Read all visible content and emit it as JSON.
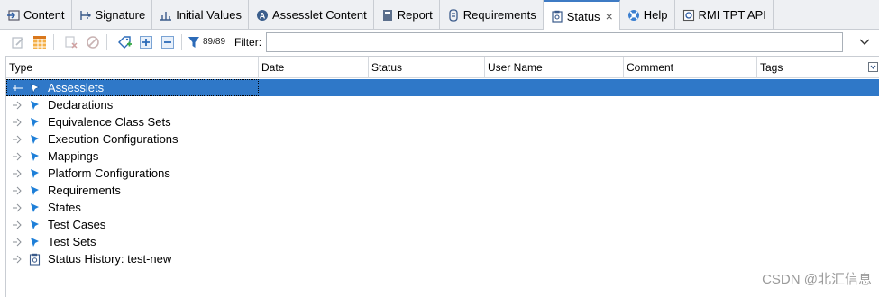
{
  "tabs": [
    {
      "label": "Content",
      "icon": "content-icon",
      "active": false
    },
    {
      "label": "Signature",
      "icon": "signature-icon",
      "active": false
    },
    {
      "label": "Initial Values",
      "icon": "initial-values-icon",
      "active": false
    },
    {
      "label": "Assesslet Content",
      "icon": "assesslet-icon",
      "active": false
    },
    {
      "label": "Report",
      "icon": "report-icon",
      "active": false
    },
    {
      "label": "Requirements",
      "icon": "requirements-icon",
      "active": false
    },
    {
      "label": "Status",
      "icon": "status-icon",
      "active": true,
      "close": "×"
    },
    {
      "label": "Help",
      "icon": "help-icon",
      "active": false
    },
    {
      "label": "RMI TPT API",
      "icon": "api-icon",
      "active": false
    }
  ],
  "toolbar": {
    "count": "89/89",
    "filter_label": "Filter:",
    "filter_value": ""
  },
  "table": {
    "columns": [
      "Type",
      "Date",
      "Status",
      "User Name",
      "Comment",
      "Tags"
    ],
    "rows": [
      {
        "label": "Assesslets",
        "selected": true,
        "icon": "pin-icon"
      },
      {
        "label": "Declarations",
        "selected": false,
        "icon": "pin-icon"
      },
      {
        "label": "Equivalence Class Sets",
        "selected": false,
        "icon": "pin-icon"
      },
      {
        "label": "Execution Configurations",
        "selected": false,
        "icon": "pin-icon"
      },
      {
        "label": "Mappings",
        "selected": false,
        "icon": "pin-icon"
      },
      {
        "label": "Platform Configurations",
        "selected": false,
        "icon": "pin-icon"
      },
      {
        "label": "Requirements",
        "selected": false,
        "icon": "pin-icon"
      },
      {
        "label": "States",
        "selected": false,
        "icon": "pin-icon"
      },
      {
        "label": "Test Cases",
        "selected": false,
        "icon": "pin-icon"
      },
      {
        "label": "Test Sets",
        "selected": false,
        "icon": "pin-icon"
      },
      {
        "label": "Status History: test-new",
        "selected": false,
        "icon": "history-icon"
      }
    ]
  },
  "watermark": "CSDN @北汇信息",
  "colors": {
    "accent": "#2f78c8",
    "tab_bg": "#eef0f3",
    "pin": "#1e7fd8"
  }
}
